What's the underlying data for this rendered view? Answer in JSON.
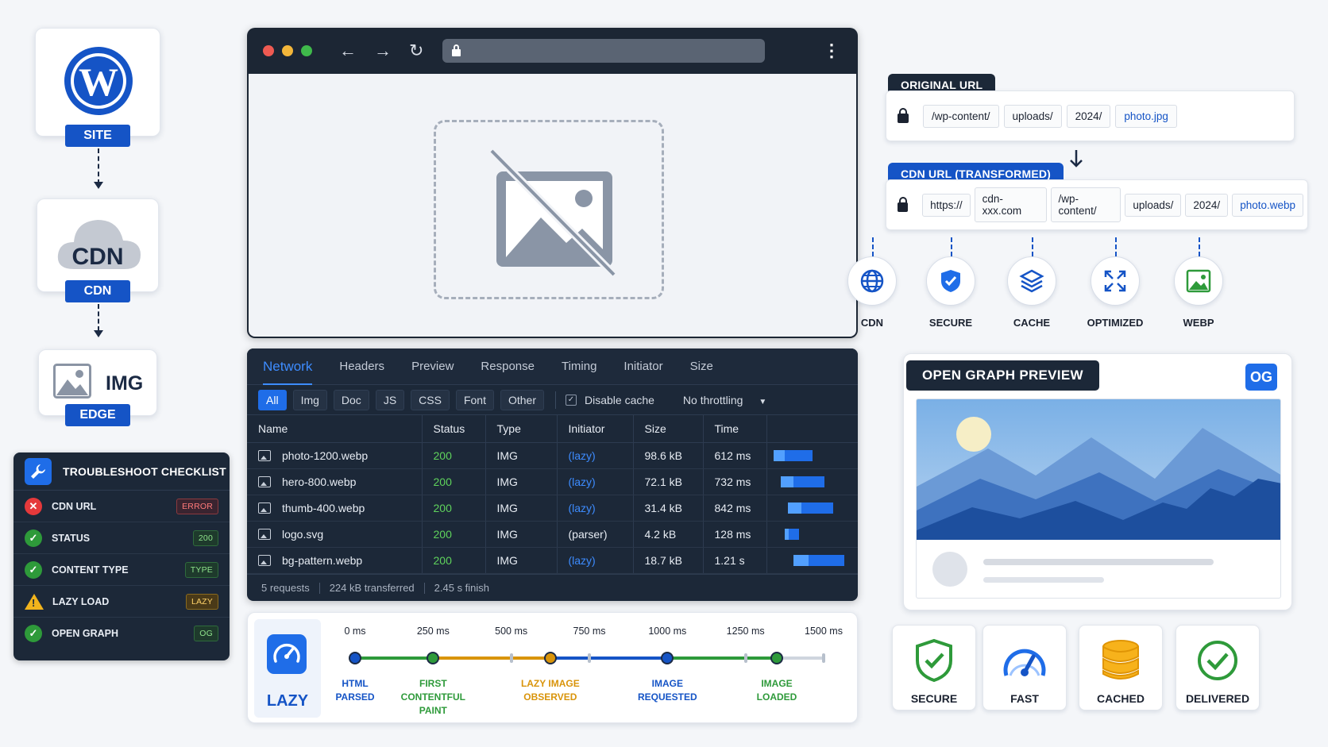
{
  "stack": {
    "site_label": "SITE",
    "cdn_text": "CDN",
    "cdn_label": "CDN",
    "img_text": "IMG",
    "edge_label": "EDGE"
  },
  "checklist": {
    "title": "TROUBLESHOOT CHECKLIST",
    "items": [
      {
        "label": "CDN URL",
        "badge": "ERROR",
        "state": "error"
      },
      {
        "label": "STATUS",
        "badge": "200",
        "state": "ok"
      },
      {
        "label": "CONTENT TYPE",
        "badge": "TYPE",
        "state": "ok"
      },
      {
        "label": "LAZY LOAD",
        "badge": "LAZY",
        "state": "warn"
      },
      {
        "label": "OPEN GRAPH",
        "badge": "OG",
        "state": "ok"
      }
    ]
  },
  "devtools": {
    "tabs": [
      "Network",
      "Headers",
      "Preview",
      "Response",
      "Timing",
      "Initiator",
      "Size"
    ],
    "filters": [
      "All",
      "Img",
      "Doc",
      "JS",
      "CSS",
      "Font",
      "Other"
    ],
    "disable_cache": "Disable cache",
    "throttling": "No throttling",
    "columns": [
      "Name",
      "Status",
      "Type",
      "Initiator",
      "Size",
      "Time"
    ],
    "rows": [
      {
        "name": "photo-1200.webp",
        "status": "200",
        "type": "IMG",
        "initiator": "(lazy)",
        "size": "98.6 kB",
        "time": "612 ms",
        "wf_start": 0.0,
        "wf_len": 0.52
      },
      {
        "name": "hero-800.webp",
        "status": "200",
        "type": "IMG",
        "initiator": "(lazy)",
        "size": "72.1 kB",
        "time": "732 ms",
        "wf_start": 0.1,
        "wf_len": 0.58
      },
      {
        "name": "thumb-400.webp",
        "status": "200",
        "type": "IMG",
        "initiator": "(lazy)",
        "size": "31.4 kB",
        "time": "842 ms",
        "wf_start": 0.2,
        "wf_len": 0.6
      },
      {
        "name": "logo.svg",
        "status": "200",
        "type": "IMG",
        "initiator": "(parser)",
        "size": "4.2 kB",
        "time": "128 ms",
        "wf_start": 0.15,
        "wf_len": 0.19
      },
      {
        "name": "bg-pattern.webp",
        "status": "200",
        "type": "IMG",
        "initiator": "(lazy)",
        "size": "18.7 kB",
        "time": "1.21 s",
        "wf_start": 0.27,
        "wf_len": 0.68
      }
    ],
    "footer": [
      "5 requests",
      "224 kB transferred",
      "2.45 s finish"
    ]
  },
  "timeline": {
    "label": "LAZY",
    "ticks": [
      "0 ms",
      "250 ms",
      "500 ms",
      "750 ms",
      "1000 ms",
      "1250 ms",
      "1500 ms"
    ],
    "max_ms": 1500,
    "events": [
      {
        "ms": 0,
        "line1": "HTML",
        "line2": "PARSED",
        "line3": "",
        "color": "#1554c6"
      },
      {
        "ms": 250,
        "line1": "FIRST",
        "line2": "CONTENTFUL",
        "line3": "PAINT",
        "color": "#2e9a3a"
      },
      {
        "ms": 625,
        "line1": "LAZY IMAGE",
        "line2": "OBSERVED",
        "line3": "",
        "color": "#d9940a"
      },
      {
        "ms": 1000,
        "line1": "IMAGE",
        "line2": "REQUESTED",
        "line3": "",
        "color": "#1554c6"
      },
      {
        "ms": 1350,
        "line1": "IMAGE",
        "line2": "LOADED",
        "line3": "",
        "color": "#2e9a3a"
      }
    ]
  },
  "urls": {
    "original_label": "ORIGINAL URL",
    "original": [
      "/wp-content/",
      "uploads/",
      "2024/",
      "photo.jpg"
    ],
    "cdn_label": "CDN URL (TRANSFORMED)",
    "cdn": [
      "https://",
      "cdn-xxx.com",
      "/wp-content/",
      "uploads/",
      "2024/",
      "photo.webp"
    ]
  },
  "features": [
    "CDN",
    "SECURE",
    "CACHE",
    "OPTIMIZED",
    "WEBP"
  ],
  "og": {
    "title": "OPEN GRAPH PREVIEW",
    "badge": "OG"
  },
  "badges": [
    "SECURE",
    "FAST",
    "CACHED",
    "DELIVERED"
  ],
  "colors": {
    "brand_blue": "#1554c6",
    "accent_blue": "#1f6de8",
    "ok_green": "#2e9a3a",
    "warn_amber": "#d9940a",
    "error_red": "#e5393b",
    "dark_panel": "#1c2838"
  }
}
